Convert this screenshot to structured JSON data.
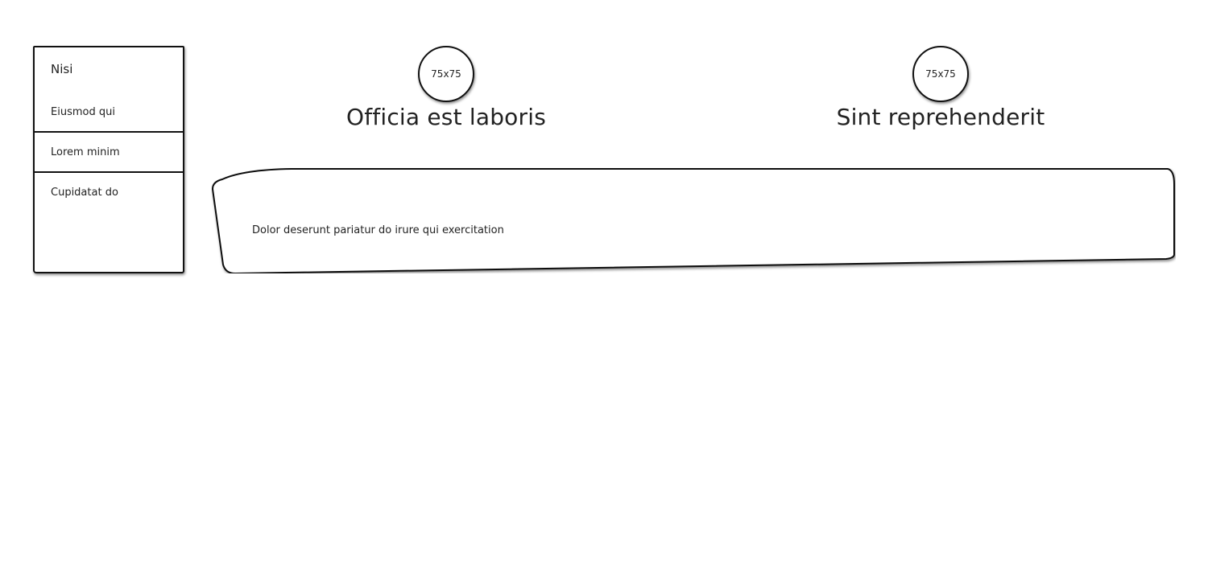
{
  "sidebar": {
    "header": "Nisi",
    "items": [
      {
        "label": "Eiusmod qui"
      },
      {
        "label": "Lorem minim"
      },
      {
        "label": "Cupidatat do"
      }
    ]
  },
  "profiles": [
    {
      "avatar_text": "75x75",
      "name": "Officia est laboris"
    },
    {
      "avatar_text": "75x75",
      "name": "Sint reprehenderit"
    }
  ],
  "panel": {
    "text": "Dolor deserunt pariatur do irure qui exercitation"
  },
  "colors": {
    "stroke": "#111111",
    "text": "#222222",
    "background": "#ffffff"
  }
}
